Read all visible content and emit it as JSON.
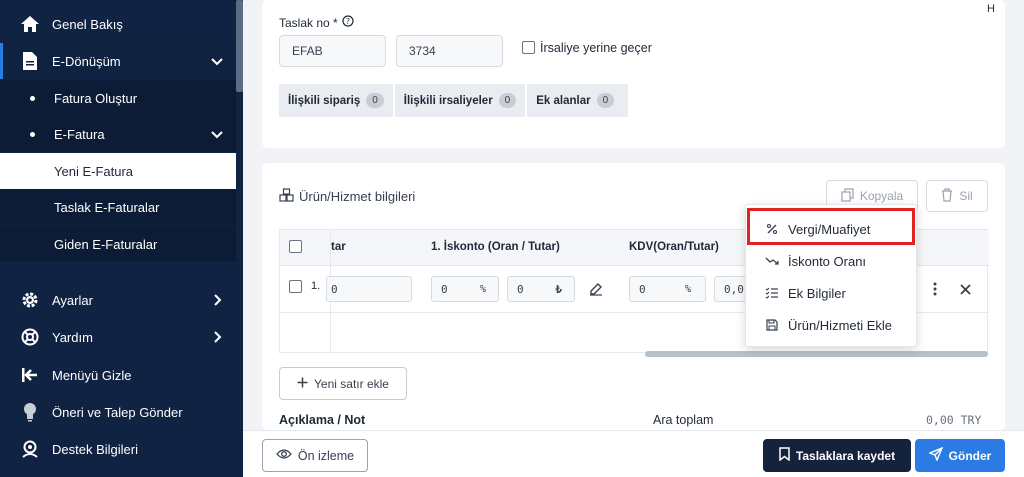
{
  "sidebar": {
    "items": [
      {
        "label": "Genel Bakış",
        "icon": "home-icon"
      },
      {
        "label": "E-Dönüşüm",
        "icon": "document-icon"
      },
      {
        "label": "Fatura Oluştur"
      },
      {
        "label": "E-Fatura"
      },
      {
        "label": "Yeni E-Fatura"
      },
      {
        "label": "Taslak E-Faturalar"
      },
      {
        "label": "Giden E-Faturalar"
      },
      {
        "label": "Ayarlar",
        "icon": "gear-icon"
      },
      {
        "label": "Yardım",
        "icon": "lifebuoy-icon"
      },
      {
        "label": "Menüyü Gizle",
        "icon": "collapse-menu-icon"
      },
      {
        "label": "Öneri ve Talep Gönder",
        "icon": "lightbulb-icon"
      },
      {
        "label": "Destek Bilgileri",
        "icon": "support-icon"
      }
    ]
  },
  "draft": {
    "label": "Taslak no *",
    "prefix": "EFAB",
    "number": "3734",
    "irsaliye_label": "İrsaliye yerine geçer",
    "corner_letter": "H"
  },
  "tabs": [
    {
      "label": "İlişkili sipariş",
      "count": "0"
    },
    {
      "label": "İlişkili irsaliyeler",
      "count": "0"
    },
    {
      "label": "Ek alanlar",
      "count": "0"
    }
  ],
  "products": {
    "title": "Ürün/Hizmet bilgileri",
    "copy_label": "Kopyala",
    "delete_label": "Sil",
    "columns": {
      "amount": "tar",
      "discount": "1. İskonto (Oran / Tutar)",
      "vat": "KDV(Oran/Tutar)"
    },
    "row": {
      "index": "1.",
      "amount": "0",
      "discount_rate": "0",
      "discount_rate_unit": "%",
      "discount_amount": "0",
      "discount_currency": "₺",
      "vat_rate": "0",
      "vat_rate_unit": "%",
      "vat_amount": "0,0"
    },
    "add_row_label": "Yeni satır ekle"
  },
  "summary": {
    "note_label": "Açıklama / Not",
    "subtotal_label": "Ara toplam",
    "subtotal_value": "0,00 TRY"
  },
  "popup_menu": [
    {
      "label": "Vergi/Muafiyet",
      "icon": "percent-icon"
    },
    {
      "label": "İskonto Oranı",
      "icon": "trend-down-icon"
    },
    {
      "label": "Ek Bilgiler",
      "icon": "checklist-icon"
    },
    {
      "label": "Ürün/Hizmeti Ekle",
      "icon": "save-icon"
    }
  ],
  "footer": {
    "preview_label": "Ön izleme",
    "save_draft_label": "Taslaklara kaydet",
    "send_label": "Gönder"
  },
  "colors": {
    "sidebar": "#102342",
    "primary": "#2b7be4",
    "dark_button": "#15223b",
    "highlight": "#e02424"
  }
}
